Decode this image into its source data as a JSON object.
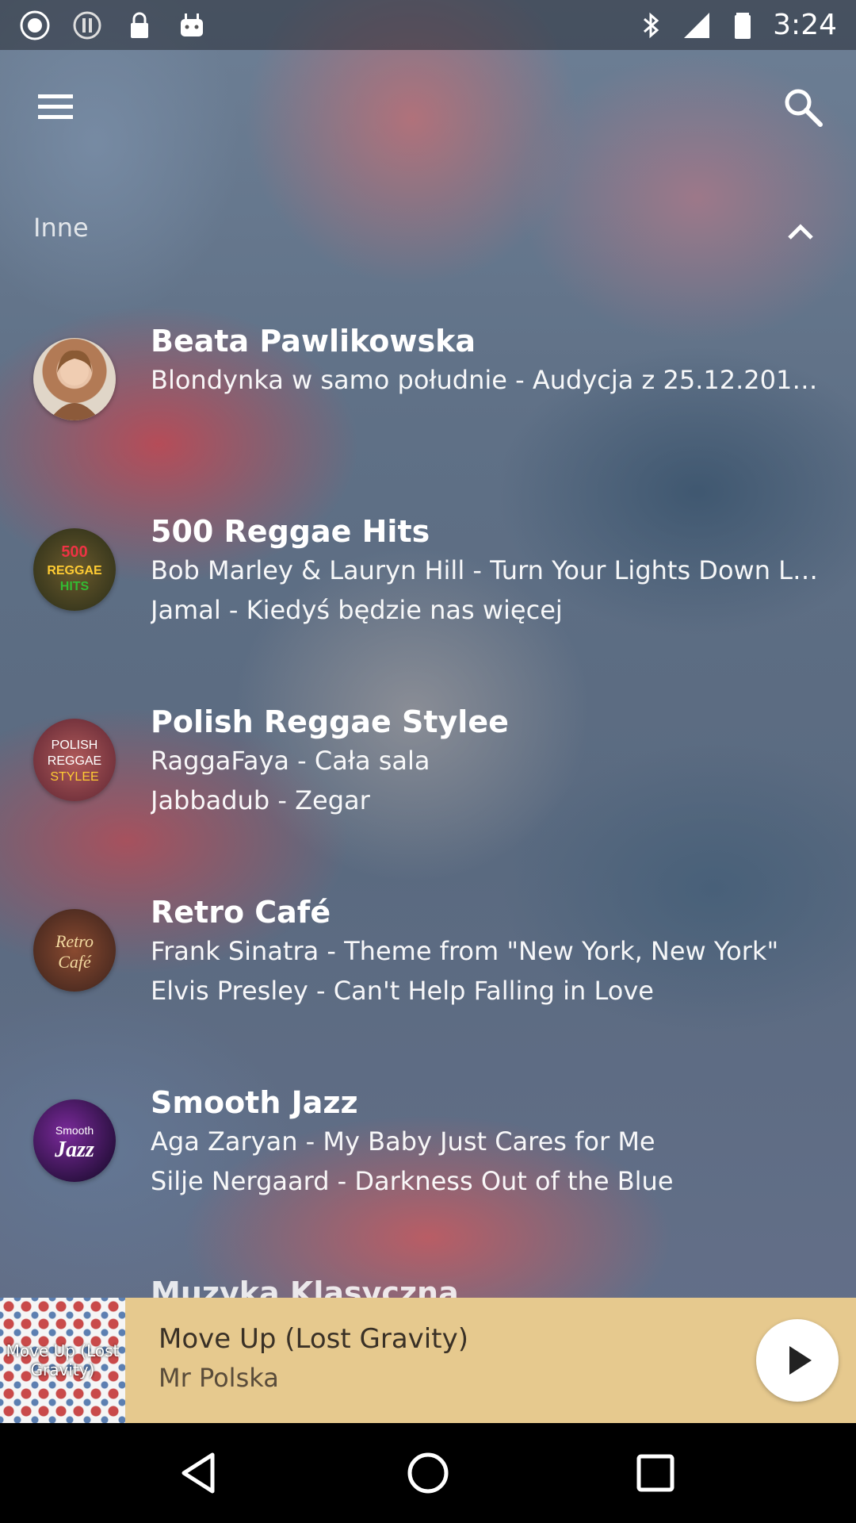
{
  "status_bar": {
    "time": "3:24",
    "icons": [
      "record-icon",
      "alert-icon",
      "lock-icon",
      "android-icon",
      "bluetooth-icon",
      "signal-icon",
      "battery-icon"
    ]
  },
  "toolbar": {
    "menu_icon": "menu-icon",
    "search_icon": "search-icon"
  },
  "section": {
    "title": "Inne",
    "collapse_icon": "chevron-up-icon"
  },
  "stations": [
    {
      "name": "Beata Pawlikowska",
      "line1": "Blondynka w samo południe - Audycja z 25.12.201…",
      "line2": "",
      "avatar_icon": "portrait-avatar"
    },
    {
      "name": "500 Reggae Hits",
      "line1": "Bob Marley & Lauryn Hill - Turn Your Lights Down L…",
      "line2": "Jamal - Kiedyś będzie nas więcej",
      "avatar_text": "500 REGGAE HITS"
    },
    {
      "name": "Polish Reggae Stylee",
      "line1": "RaggaFaya - Cała sala",
      "line2": "Jabbadub - Zegar",
      "avatar_text": "POLISH REGGAE STYLEE"
    },
    {
      "name": "Retro Café",
      "line1": "Frank Sinatra - Theme from \"New York, New York\"",
      "line2": "Elvis Presley - Can't Help Falling in Love",
      "avatar_text": "Retro Café"
    },
    {
      "name": "Smooth Jazz",
      "line1": "Aga Zaryan - My Baby Just Cares for Me",
      "line2": "Silje Nergaard - Darkness Out of the Blue",
      "avatar_text": "Smooth Jazz"
    },
    {
      "name": "Muzyka Klasyczna",
      "line1": "",
      "line2": ""
    }
  ],
  "player": {
    "title": "Move Up (Lost Gravity)",
    "artist": "Mr Polska",
    "cover_text": "Move Up (Lost Gravity)",
    "play_icon": "play-icon"
  },
  "nav": {
    "back_icon": "back-icon",
    "home_icon": "home-icon",
    "recents_icon": "recents-icon"
  },
  "colors": {
    "player_bg": "#e6c98e",
    "nav_bg": "#000000",
    "text": "#ffffff"
  }
}
